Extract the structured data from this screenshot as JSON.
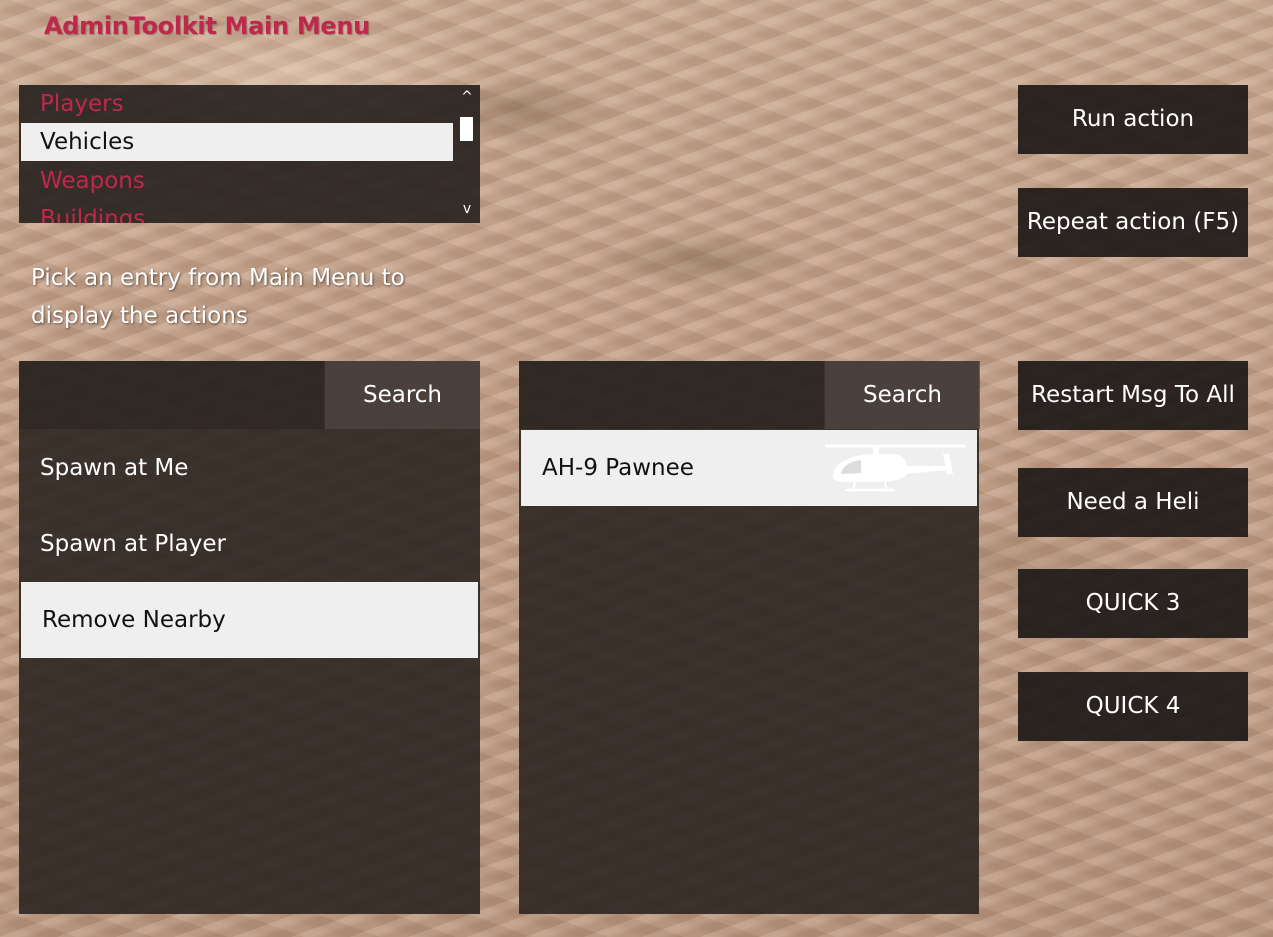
{
  "app": {
    "title": "AdminToolkit Main Menu",
    "accent_color": "#c0284b"
  },
  "main_menu": {
    "items": [
      {
        "label": "Players",
        "selected": false
      },
      {
        "label": "Vehicles",
        "selected": true
      },
      {
        "label": "Weapons",
        "selected": false
      },
      {
        "label": "Buildings",
        "selected": false
      }
    ],
    "scroll_up_icon": "^",
    "scroll_down_icon": "v"
  },
  "hint": {
    "text": "Pick an entry from Main Menu to display the actions"
  },
  "actions_panel": {
    "search_value": "",
    "search_label": "Search",
    "items": [
      {
        "label": "Spawn at Me",
        "selected": false
      },
      {
        "label": "Spawn at Player",
        "selected": false
      },
      {
        "label": "Remove Nearby",
        "selected": true
      }
    ]
  },
  "results_panel": {
    "search_value": "",
    "search_label": "Search",
    "items": [
      {
        "label": "AH-9 Pawnee",
        "selected": true,
        "icon": "helicopter-icon"
      }
    ]
  },
  "buttons": {
    "run_action": "Run action",
    "repeat_action": "Repeat action (F5)",
    "restart_msg": "Restart Msg To All",
    "need_heli": "Need a Heli",
    "quick3": "QUICK 3",
    "quick4": "QUICK 4"
  }
}
